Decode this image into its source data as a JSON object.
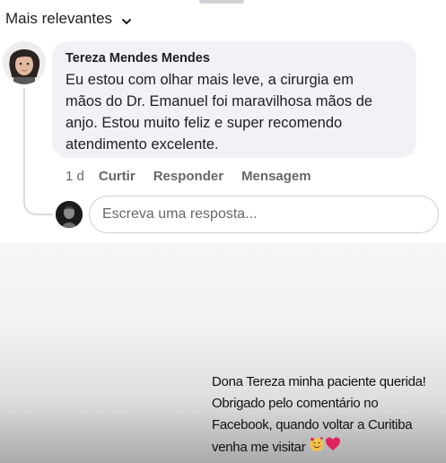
{
  "sort": {
    "label": "Mais relevantes",
    "icon": "chevron-down-icon"
  },
  "comment": {
    "author": "Tereza Mendes Mendes",
    "text": "Eu estou com olhar mais leve, a cirurgia em mãos do Dr. Emanuel foi maravilhosa mãos de anjo. Estou muito feliz e super recomendo atendimento excelente.",
    "text_lines": [
      "Eu estou com olhar mais leve, a cirurgia em",
      "mãos do Dr. Emanuel foi maravilhosa mãos de",
      "anjo. Estou muito feliz e super recomendo",
      "atendimento excelente."
    ],
    "time": "1 d",
    "actions": {
      "like": "Curtir",
      "reply": "Responder",
      "message": "Mensagem"
    }
  },
  "reply": {
    "placeholder": "Escreva uma resposta..."
  },
  "story_caption": {
    "lines": [
      "Dona Tereza minha paciente querida!",
      "Obrigado pelo comentário no",
      "Facebook, quando voltar a Curitiba",
      "venha me visitar"
    ],
    "emojis": [
      "smiling-face-with-hearts-emoji",
      "red-heart-emoji"
    ]
  },
  "colors": {
    "bubble": "#f0f2f5",
    "text": "#1c1e21",
    "secondary": "#65676b",
    "heart": "#e0245e"
  }
}
